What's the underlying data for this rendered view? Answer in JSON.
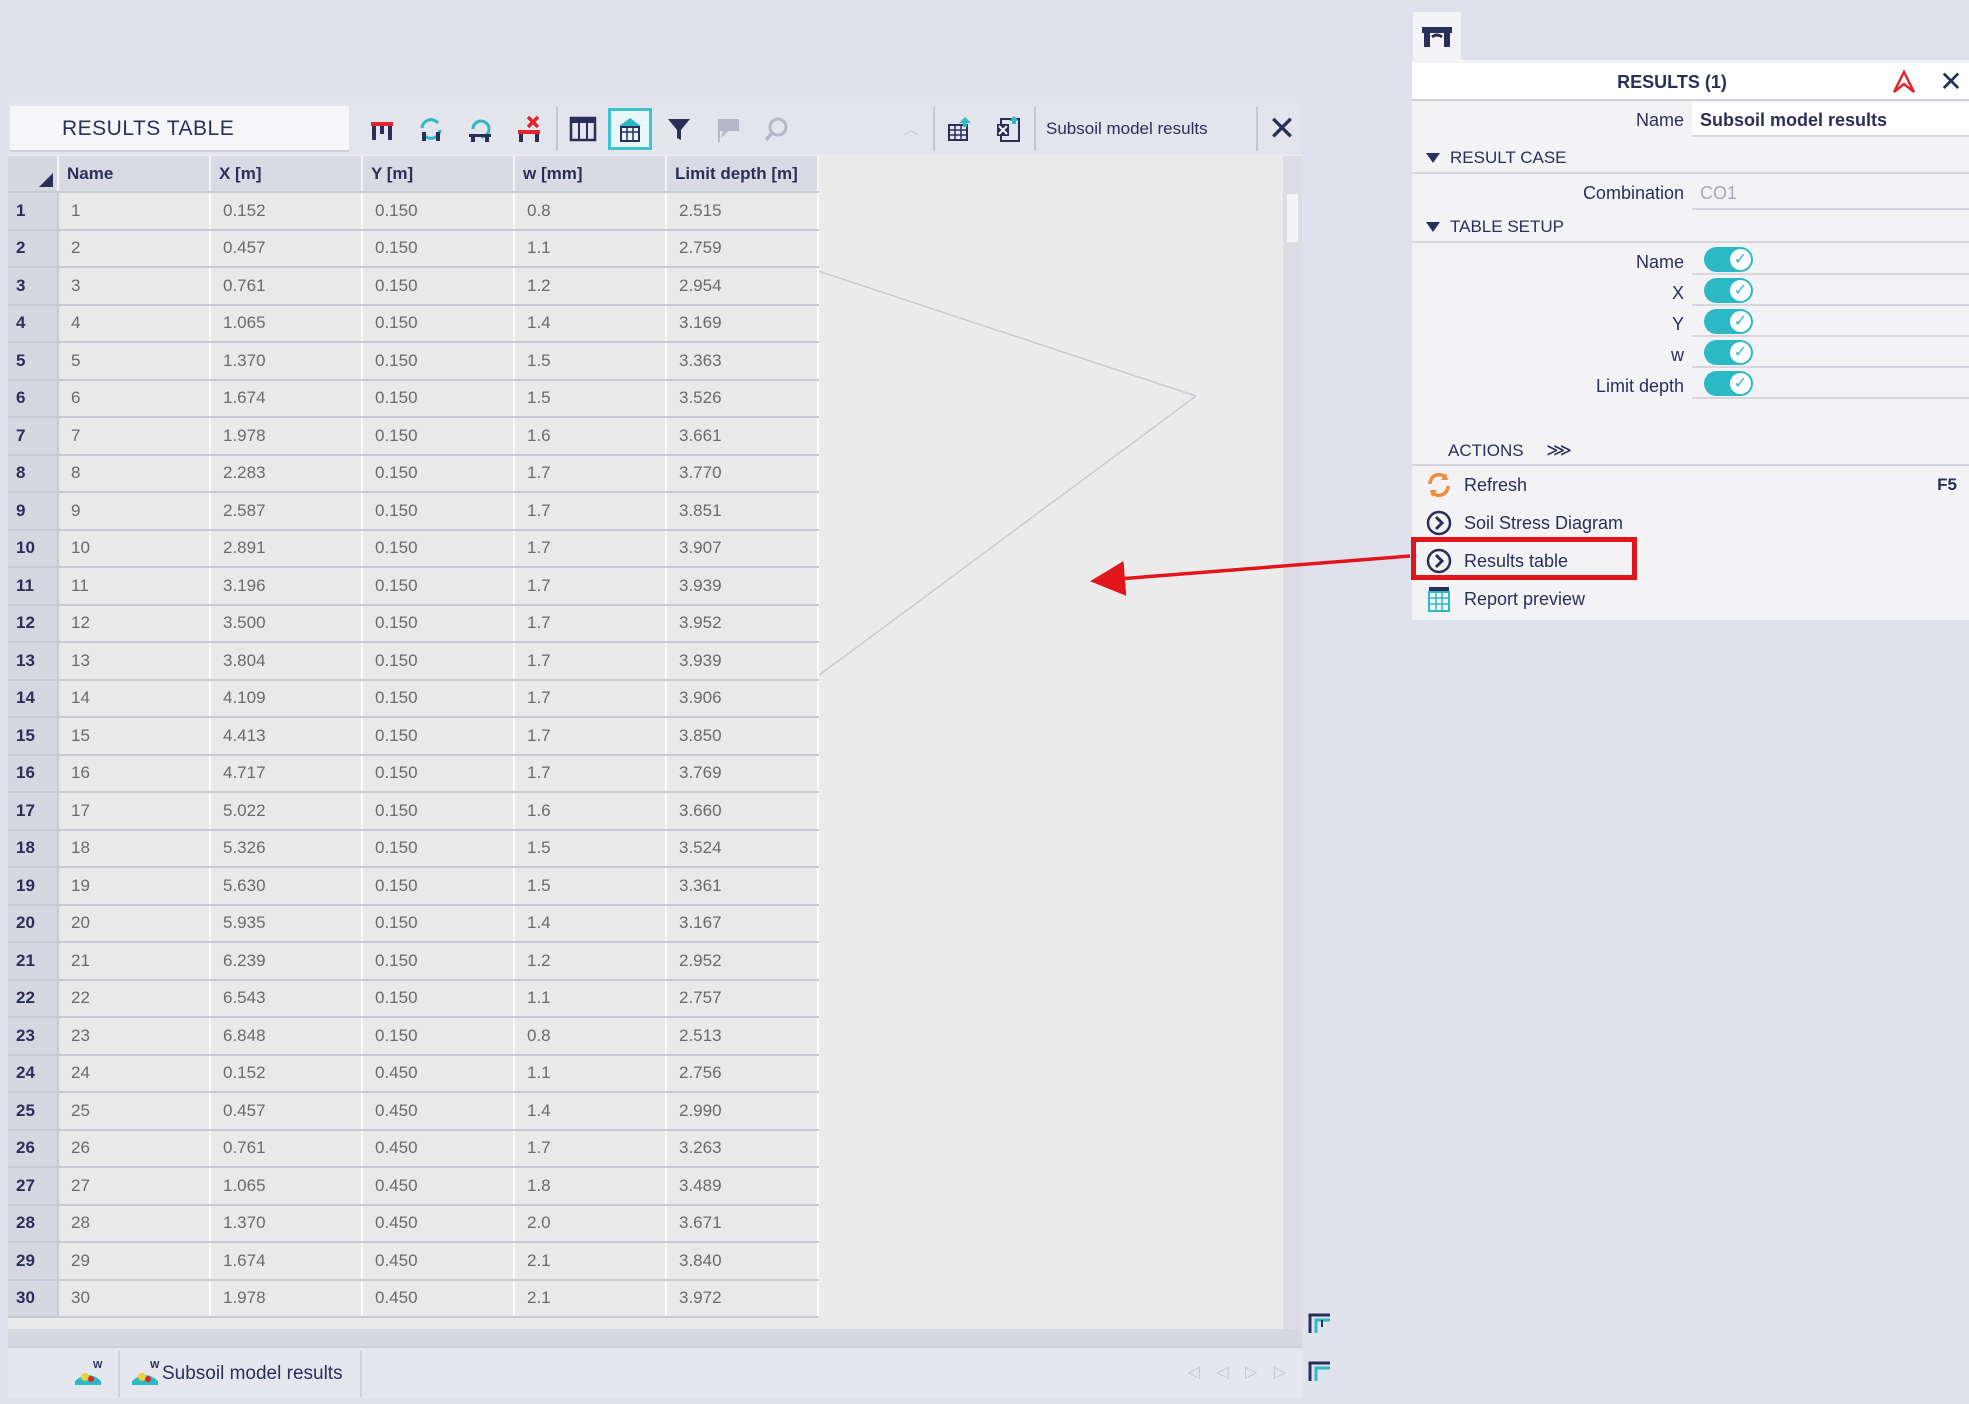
{
  "results_table": {
    "title": "RESULTS TABLE",
    "source_label": "Subsoil model results",
    "close_label": "✕",
    "columns": [
      "Name",
      "X [m]",
      "Y [m]",
      "w [mm]",
      "Limit depth [m]"
    ],
    "rows": [
      {
        "n": "1",
        "name": "1",
        "x": "0.152",
        "y": "0.150",
        "w": "0.8",
        "ld": "2.515"
      },
      {
        "n": "2",
        "name": "2",
        "x": "0.457",
        "y": "0.150",
        "w": "1.1",
        "ld": "2.759"
      },
      {
        "n": "3",
        "name": "3",
        "x": "0.761",
        "y": "0.150",
        "w": "1.2",
        "ld": "2.954"
      },
      {
        "n": "4",
        "name": "4",
        "x": "1.065",
        "y": "0.150",
        "w": "1.4",
        "ld": "3.169"
      },
      {
        "n": "5",
        "name": "5",
        "x": "1.370",
        "y": "0.150",
        "w": "1.5",
        "ld": "3.363"
      },
      {
        "n": "6",
        "name": "6",
        "x": "1.674",
        "y": "0.150",
        "w": "1.5",
        "ld": "3.526"
      },
      {
        "n": "7",
        "name": "7",
        "x": "1.978",
        "y": "0.150",
        "w": "1.6",
        "ld": "3.661"
      },
      {
        "n": "8",
        "name": "8",
        "x": "2.283",
        "y": "0.150",
        "w": "1.7",
        "ld": "3.770"
      },
      {
        "n": "9",
        "name": "9",
        "x": "2.587",
        "y": "0.150",
        "w": "1.7",
        "ld": "3.851"
      },
      {
        "n": "10",
        "name": "10",
        "x": "2.891",
        "y": "0.150",
        "w": "1.7",
        "ld": "3.907"
      },
      {
        "n": "11",
        "name": "11",
        "x": "3.196",
        "y": "0.150",
        "w": "1.7",
        "ld": "3.939"
      },
      {
        "n": "12",
        "name": "12",
        "x": "3.500",
        "y": "0.150",
        "w": "1.7",
        "ld": "3.952"
      },
      {
        "n": "13",
        "name": "13",
        "x": "3.804",
        "y": "0.150",
        "w": "1.7",
        "ld": "3.939"
      },
      {
        "n": "14",
        "name": "14",
        "x": "4.109",
        "y": "0.150",
        "w": "1.7",
        "ld": "3.906"
      },
      {
        "n": "15",
        "name": "15",
        "x": "4.413",
        "y": "0.150",
        "w": "1.7",
        "ld": "3.850"
      },
      {
        "n": "16",
        "name": "16",
        "x": "4.717",
        "y": "0.150",
        "w": "1.7",
        "ld": "3.769"
      },
      {
        "n": "17",
        "name": "17",
        "x": "5.022",
        "y": "0.150",
        "w": "1.6",
        "ld": "3.660"
      },
      {
        "n": "18",
        "name": "18",
        "x": "5.326",
        "y": "0.150",
        "w": "1.5",
        "ld": "3.524"
      },
      {
        "n": "19",
        "name": "19",
        "x": "5.630",
        "y": "0.150",
        "w": "1.5",
        "ld": "3.361"
      },
      {
        "n": "20",
        "name": "20",
        "x": "5.935",
        "y": "0.150",
        "w": "1.4",
        "ld": "3.167"
      },
      {
        "n": "21",
        "name": "21",
        "x": "6.239",
        "y": "0.150",
        "w": "1.2",
        "ld": "2.952"
      },
      {
        "n": "22",
        "name": "22",
        "x": "6.543",
        "y": "0.150",
        "w": "1.1",
        "ld": "2.757"
      },
      {
        "n": "23",
        "name": "23",
        "x": "6.848",
        "y": "0.150",
        "w": "0.8",
        "ld": "2.513"
      },
      {
        "n": "24",
        "name": "24",
        "x": "0.152",
        "y": "0.450",
        "w": "1.1",
        "ld": "2.756"
      },
      {
        "n": "25",
        "name": "25",
        "x": "0.457",
        "y": "0.450",
        "w": "1.4",
        "ld": "2.990"
      },
      {
        "n": "26",
        "name": "26",
        "x": "0.761",
        "y": "0.450",
        "w": "1.7",
        "ld": "3.263"
      },
      {
        "n": "27",
        "name": "27",
        "x": "1.065",
        "y": "0.450",
        "w": "1.8",
        "ld": "3.489"
      },
      {
        "n": "28",
        "name": "28",
        "x": "1.370",
        "y": "0.450",
        "w": "2.0",
        "ld": "3.671"
      },
      {
        "n": "29",
        "name": "29",
        "x": "1.674",
        "y": "0.450",
        "w": "2.1",
        "ld": "3.840"
      },
      {
        "n": "30",
        "name": "30",
        "x": "1.978",
        "y": "0.450",
        "w": "2.1",
        "ld": "3.972"
      }
    ]
  },
  "toolbar": {
    "icons": [
      "structure-icon",
      "refresh-structure-icon",
      "regenerate-icon",
      "delete-results-icon",
      "columns-icon",
      "results-view-icon",
      "filter-icon",
      "comment-icon",
      "find-icon",
      "export-table-icon",
      "export-excel-icon"
    ]
  },
  "tab_bar": {
    "tab_label": "Subsoil model results",
    "nav_label": "◁ ◁ ▷ ▷"
  },
  "panel": {
    "title": "RESULTS (1)",
    "close_label": "✕",
    "name_label": "Name",
    "name_value": "Subsoil model results",
    "result_case_header": "RESULT CASE",
    "combination_label": "Combination",
    "combination_value": "CO1",
    "table_setup_header": "TABLE SETUP",
    "toggles": [
      {
        "label": "Name",
        "on": true
      },
      {
        "label": "X",
        "on": true
      },
      {
        "label": "Y",
        "on": true
      },
      {
        "label": "w",
        "on": true
      },
      {
        "label": "Limit depth",
        "on": true
      }
    ],
    "actions_header": "ACTIONS",
    "actions_chevron": "⋙",
    "actions": [
      {
        "label": "Refresh",
        "key": "F5",
        "icon": "refresh-icon"
      },
      {
        "label": "Soil Stress Diagram",
        "key": "",
        "icon": "chevron-circle-icon"
      },
      {
        "label": "Results table",
        "key": "",
        "icon": "chevron-circle-icon"
      },
      {
        "label": "Report preview",
        "key": "",
        "icon": "report-icon"
      }
    ]
  },
  "colors": {
    "accent": "#2cb9c6",
    "highlight": "#e2151b",
    "text": "#2a2f5a"
  }
}
